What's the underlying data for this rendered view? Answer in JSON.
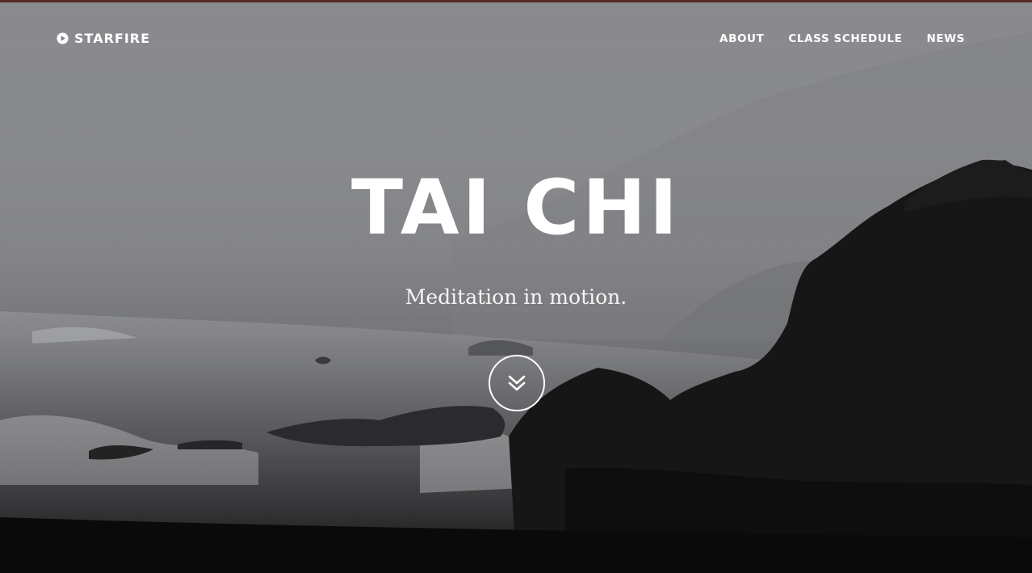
{
  "nav": {
    "brand": "STARFIRE",
    "brand_icon": "play-circle-icon",
    "links": [
      "ABOUT",
      "CLASS SCHEDULE",
      "NEWS"
    ]
  },
  "hero": {
    "title": "TAI CHI",
    "subtitle": "Meditation in motion.",
    "scroll_icon": "double-chevron-down-icon"
  },
  "colors": {
    "text": "#ffffff",
    "accent_strip": "#5a2a22",
    "sky": "#8a8b8e",
    "rock": "#121213"
  }
}
